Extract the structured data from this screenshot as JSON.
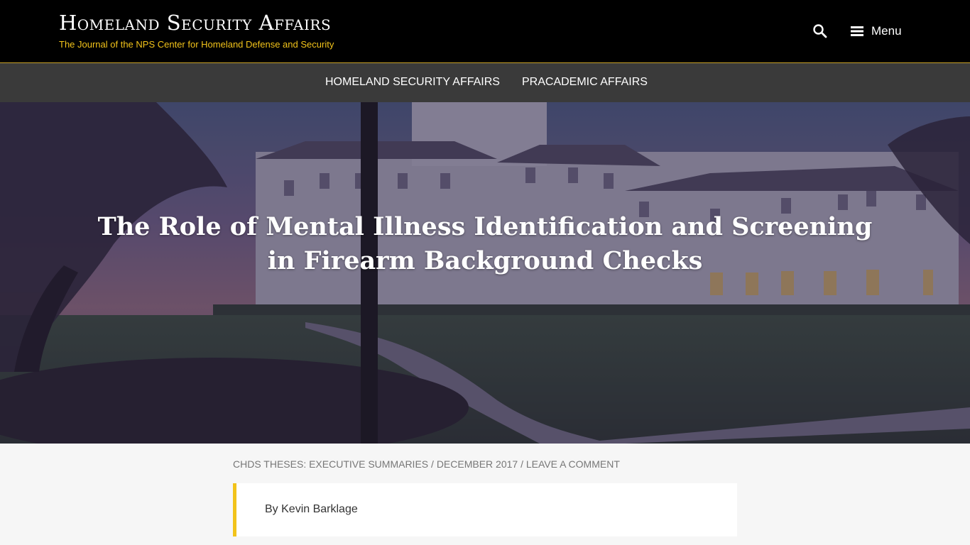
{
  "header": {
    "site_title": "Homeland Security Affairs",
    "tagline": "The Journal of the NPS Center for Homeland Defense and Security",
    "search_icon": "search-icon",
    "menu_label": "Menu",
    "menu_icon": "hamburger-icon",
    "accent_color": "#f2c31a"
  },
  "nav": {
    "items": [
      {
        "label": "HOMELAND SECURITY AFFAIRS"
      },
      {
        "label": "PRACADEMIC AFFAIRS"
      }
    ]
  },
  "hero": {
    "title": "The Role of Mental Illness Identification and Screening in Firearm Background Checks"
  },
  "post_meta": {
    "category": "CHDS THESES: EXECUTIVE SUMMARIES",
    "separator": "/",
    "date": "DECEMBER 2017",
    "comment_link": "LEAVE A COMMENT"
  },
  "byline": {
    "text": "By Kevin Barklage"
  }
}
